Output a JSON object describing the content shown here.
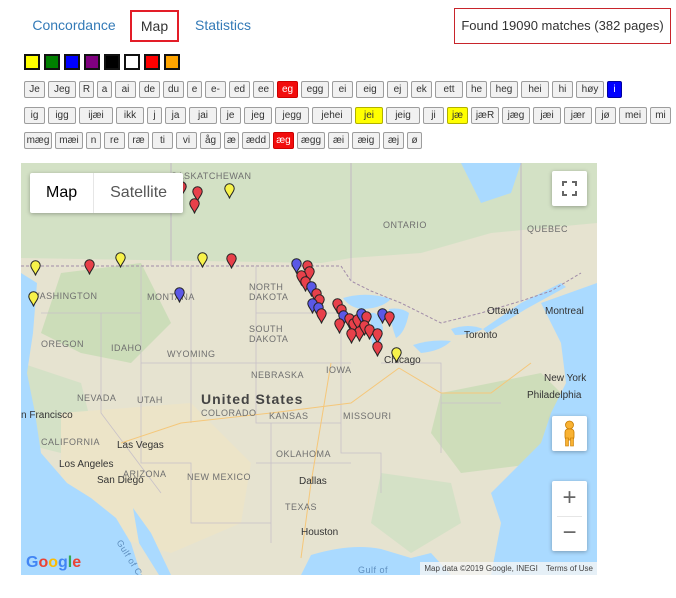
{
  "tabs": {
    "concordance": "Concordance",
    "map": "Map",
    "statistics": "Statistics"
  },
  "matches_text": "Found 19090 matches (382 pages)",
  "colors": [
    "#ffff00",
    "#008000",
    "#0000ff",
    "#800080",
    "#000000",
    "#ffffff",
    "#ff0000",
    "#ffa500"
  ],
  "chips_row1": [
    {
      "label": "Je",
      "color": "none"
    },
    {
      "label": "Jeg",
      "color": "none"
    },
    {
      "label": "R",
      "color": "none"
    },
    {
      "label": "a",
      "color": "none"
    },
    {
      "label": "ai",
      "color": "none"
    },
    {
      "label": "de",
      "color": "none"
    },
    {
      "label": "du",
      "color": "none"
    },
    {
      "label": "e",
      "color": "none"
    },
    {
      "label": "e-",
      "color": "none"
    },
    {
      "label": "ed",
      "color": "none"
    },
    {
      "label": "ee",
      "color": "none"
    },
    {
      "label": "eg",
      "color": "red"
    },
    {
      "label": "egg",
      "color": "none"
    },
    {
      "label": "ei",
      "color": "none"
    },
    {
      "label": "eig",
      "color": "none"
    },
    {
      "label": "ej",
      "color": "none"
    },
    {
      "label": "ek",
      "color": "none"
    },
    {
      "label": "ett",
      "color": "none"
    },
    {
      "label": "he",
      "color": "none"
    },
    {
      "label": "heg",
      "color": "none"
    },
    {
      "label": "hei",
      "color": "none"
    },
    {
      "label": "hi",
      "color": "none"
    },
    {
      "label": "høy",
      "color": "none"
    },
    {
      "label": "i",
      "color": "blue"
    }
  ],
  "chips_row2": [
    {
      "label": "ig",
      "color": "none"
    },
    {
      "label": "igg",
      "color": "none"
    },
    {
      "label": "ijæi",
      "color": "none"
    },
    {
      "label": "ikk",
      "color": "none"
    },
    {
      "label": "j",
      "color": "none"
    },
    {
      "label": "ja",
      "color": "none"
    },
    {
      "label": "jai",
      "color": "none"
    },
    {
      "label": "je",
      "color": "none"
    },
    {
      "label": "jeg",
      "color": "none"
    },
    {
      "label": "jegg",
      "color": "none"
    },
    {
      "label": "jehei",
      "color": "none"
    },
    {
      "label": "jei",
      "color": "yellow"
    },
    {
      "label": "jeig",
      "color": "none"
    },
    {
      "label": "ji",
      "color": "none"
    },
    {
      "label": "jæ",
      "color": "yellow"
    },
    {
      "label": "jæR",
      "color": "none"
    },
    {
      "label": "jæg",
      "color": "none"
    },
    {
      "label": "jæi",
      "color": "none"
    },
    {
      "label": "jær",
      "color": "none"
    },
    {
      "label": "jø",
      "color": "none"
    },
    {
      "label": "mei",
      "color": "none"
    },
    {
      "label": "mi",
      "color": "none"
    }
  ],
  "chips_row3": [
    {
      "label": "mæg",
      "color": "none"
    },
    {
      "label": "mæi",
      "color": "none"
    },
    {
      "label": "n",
      "color": "none"
    },
    {
      "label": "re",
      "color": "none"
    },
    {
      "label": "ræ",
      "color": "none"
    },
    {
      "label": "ti",
      "color": "none"
    },
    {
      "label": "vi",
      "color": "none"
    },
    {
      "label": "åg",
      "color": "none"
    },
    {
      "label": "æ",
      "color": "none"
    },
    {
      "label": "ædd",
      "color": "none"
    },
    {
      "label": "æg",
      "color": "red"
    },
    {
      "label": "ægg",
      "color": "none"
    },
    {
      "label": "æi",
      "color": "none"
    },
    {
      "label": "æig",
      "color": "none"
    },
    {
      "label": "æj",
      "color": "none"
    },
    {
      "label": "ø",
      "color": "none"
    }
  ],
  "map": {
    "map_type_map": "Map",
    "map_type_satellite": "Satellite",
    "fullscreen_icon": "fullscreen-icon",
    "pegman_icon": "pegman-icon",
    "zoom_in": "+",
    "zoom_out": "−",
    "google_logo": "Google",
    "attribution": "Map data ©2019 Google, INEGI",
    "terms": "Terms of Use",
    "labels": {
      "saskatchewan": "SASKATCHEWAN",
      "ontario": "ONTARIO",
      "quebec": "QUEBEC",
      "washington": "WASHINGTON",
      "montana": "MONTANA",
      "north_dakota": "NORTH\nDAKOTA",
      "south_dakota": "SOUTH\nDAKOTA",
      "oregon": "OREGON",
      "idaho": "IDAHO",
      "wyoming": "WYOMING",
      "nebraska": "NEBRASKA",
      "iowa": "IOWA",
      "nevada": "NEVADA",
      "utah": "UTAH",
      "colorado": "COLORADO",
      "kansas": "KANSAS",
      "missouri": "MISSOURI",
      "california": "CALIFORNIA",
      "arizona": "ARIZONA",
      "new_mexico": "NEW MEXICO",
      "oklahoma": "OKLAHOMA",
      "texas": "TEXAS",
      "united_states": "United States",
      "san_francisco": "n Francisco",
      "las_vegas": "Las Vegas",
      "los_angeles": "Los Angeles",
      "san_diego": "San Diego",
      "dallas": "Dallas",
      "houston": "Houston",
      "chicago": "Chicago",
      "toronto": "Toronto",
      "ottawa": "Ottawa",
      "montreal": "Montreal",
      "new_york": "New York",
      "philadelphia": "Philadelphia",
      "gulf_of": "Gulf of",
      "gulf_of_california": "Gulf of California"
    }
  },
  "pin_colors": {
    "red": "#e8404a",
    "blue": "#5b58e6",
    "yellow": "#f7f24a"
  }
}
